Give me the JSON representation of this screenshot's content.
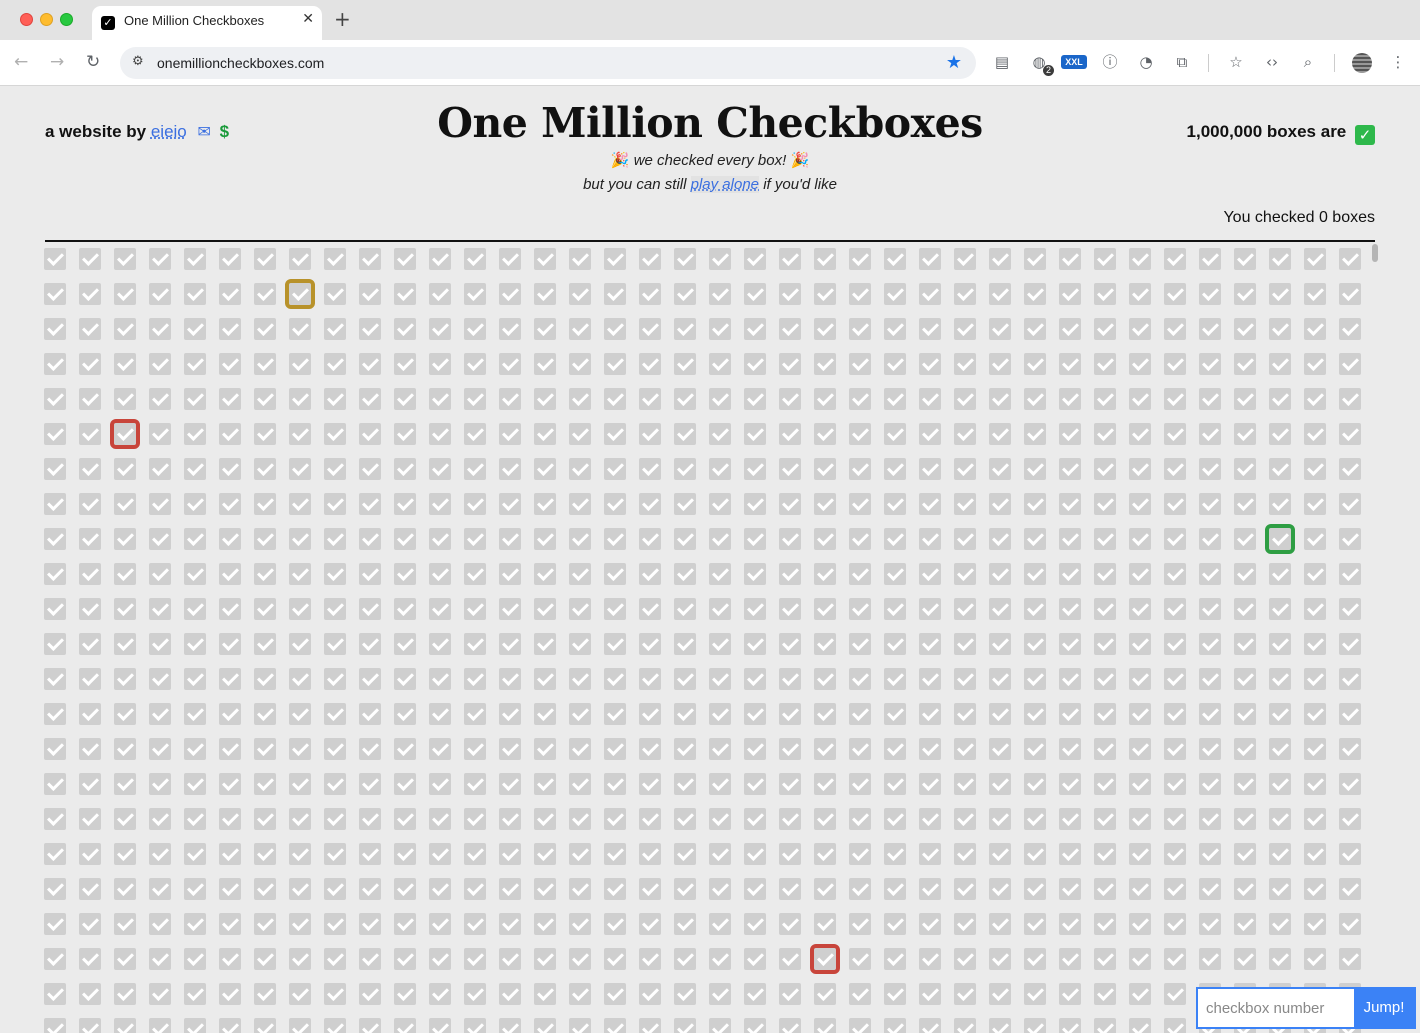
{
  "browser": {
    "tab_title": "One Million Checkboxes",
    "tab_favicon": "✓",
    "url": "onemillioncheckboxes.com",
    "extension_badge_count": "2",
    "extension_xxl_label": "XXL"
  },
  "header": {
    "byline_prefix": "a website by",
    "author_link": "eieio",
    "mail_icon": "✉",
    "dollar_icon": "$",
    "title": "One Million Checkboxes",
    "subtitle_line1": "we checked every box!",
    "party_icon": "🎉",
    "subtitle_line2_prefix": "but you can still",
    "play_alone_link": "play alone",
    "subtitle_line2_suffix": "if you'd like",
    "status_text": "1,000,000 boxes are",
    "status_icon": "✓",
    "checked_count": "You checked 0 boxes"
  },
  "grid": {
    "columns": 38,
    "rows": 23,
    "all_checked": true,
    "highlighted": [
      {
        "row": 1,
        "col": 7,
        "color": "#b8922a"
      },
      {
        "row": 5,
        "col": 2,
        "color": "#c8453b"
      },
      {
        "row": 8,
        "col": 35,
        "color": "#2e9e43"
      },
      {
        "row": 20,
        "col": 22,
        "color": "#c8453b"
      }
    ]
  },
  "jump": {
    "placeholder": "checkbox number",
    "button_label": "Jump!"
  },
  "colors": {
    "link": "#3b6fe0",
    "accent_blue": "#3b82f6",
    "checkbox_checked": "#cfcfcf"
  }
}
